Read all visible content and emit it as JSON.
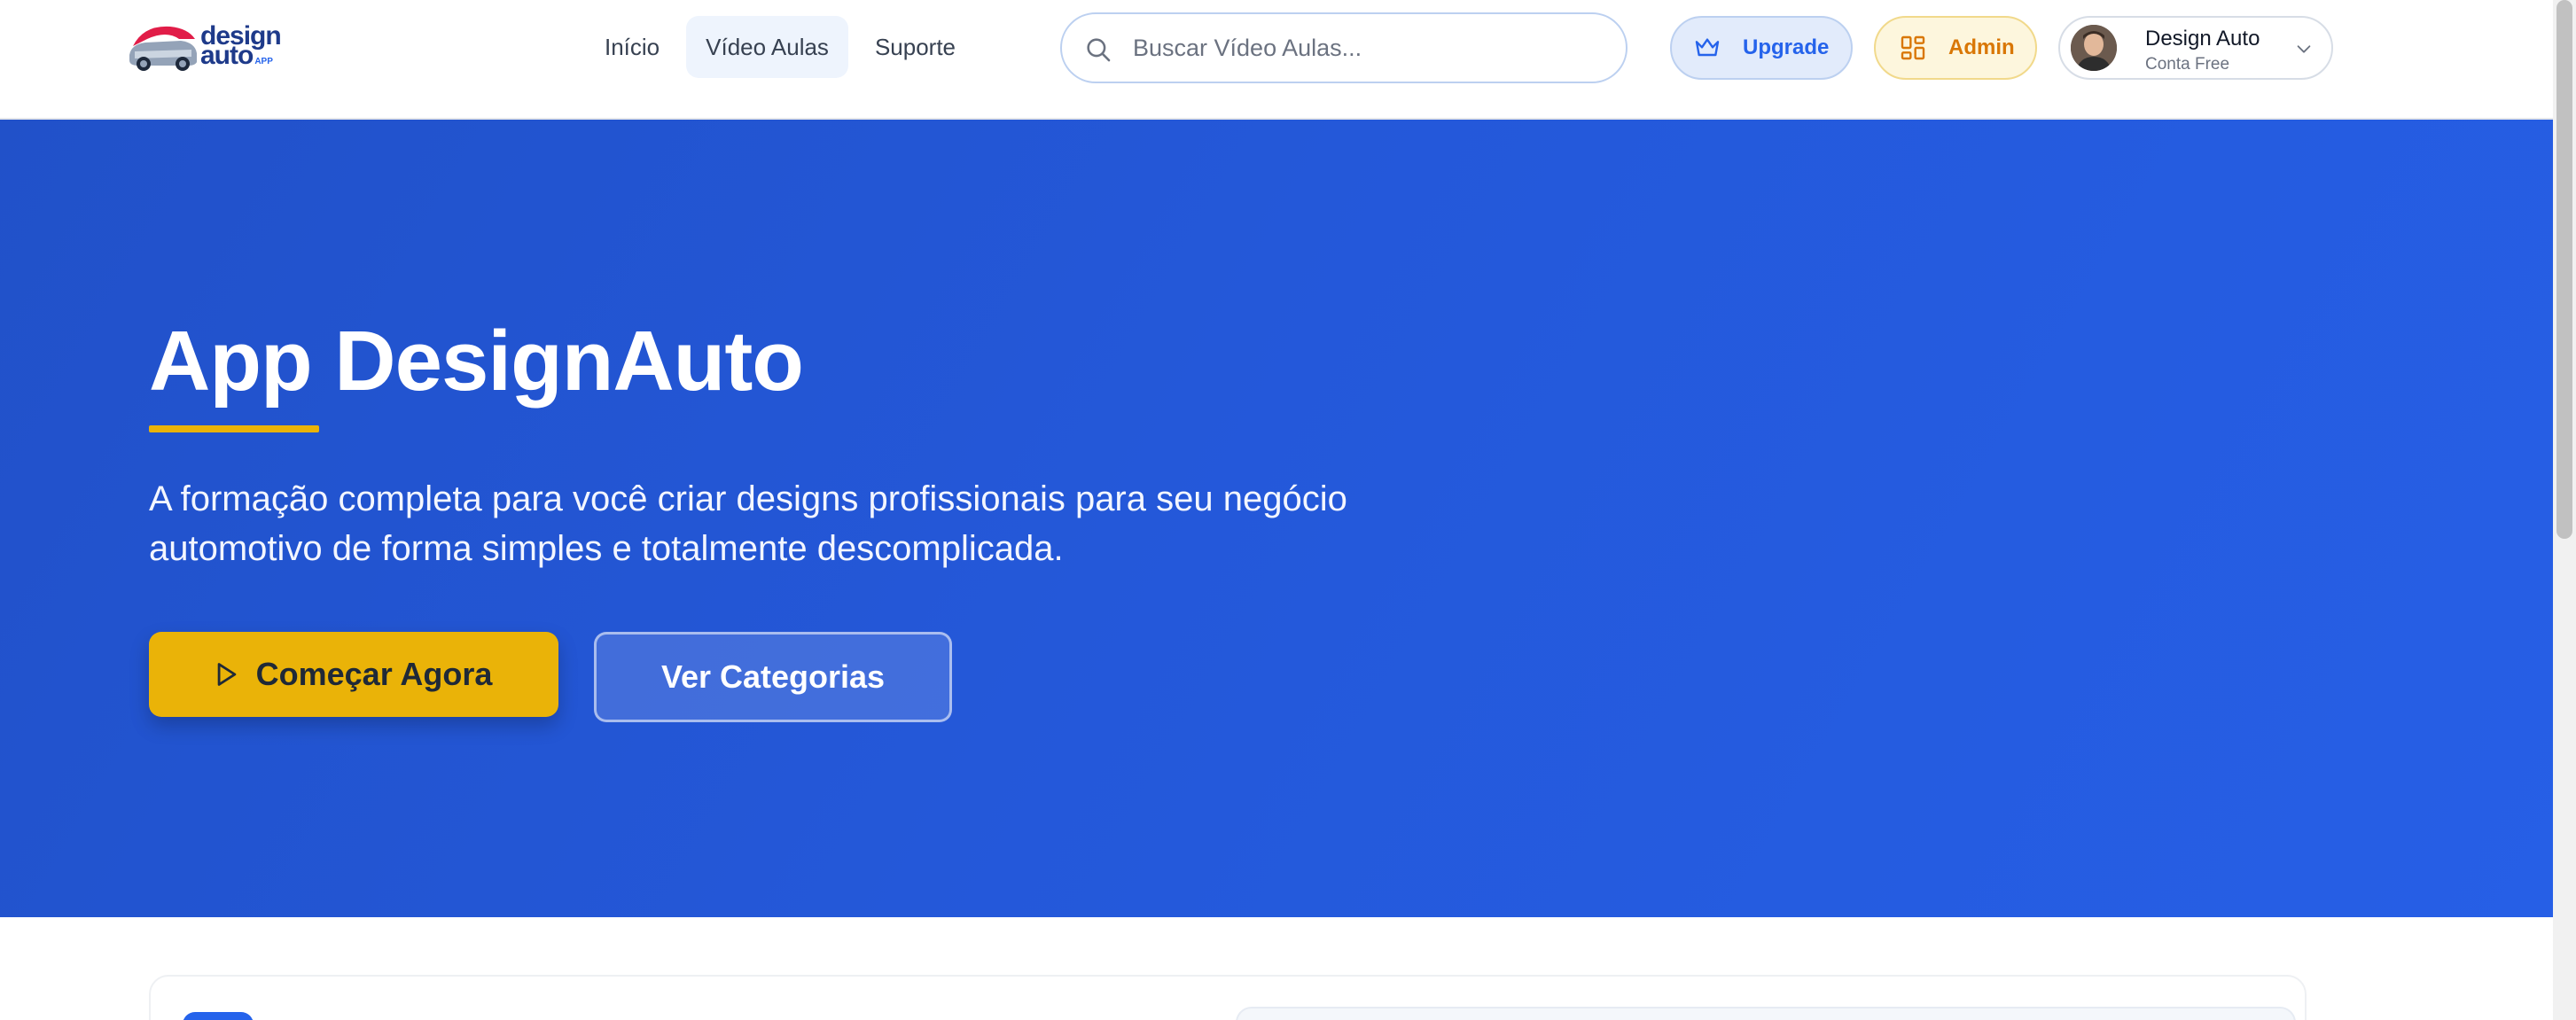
{
  "header": {
    "logo": {
      "line1": "design",
      "line2": "auto",
      "line3": "APP"
    },
    "nav": [
      {
        "label": "Início",
        "active": false
      },
      {
        "label": "Vídeo Aulas",
        "active": true
      },
      {
        "label": "Suporte",
        "active": false
      }
    ],
    "search": {
      "placeholder": "Buscar Vídeo Aulas...",
      "icon": "search-icon"
    },
    "upgrade": {
      "label": "Upgrade",
      "icon": "crown-icon",
      "color": "#2563eb"
    },
    "admin": {
      "label": "Admin",
      "icon": "dashboard-icon",
      "color": "#d97706"
    },
    "user": {
      "name": "Design Auto",
      "plan": "Conta Free"
    }
  },
  "hero": {
    "title": "App DesignAuto",
    "subtitle": "A formação completa para você criar designs profissionais para seu negócio automotivo de forma simples e totalmente descomplicada.",
    "primary_button": "Começar Agora",
    "secondary_button": "Ver Categorias",
    "accent_color": "#eab308",
    "background_color": "#2458d9"
  }
}
